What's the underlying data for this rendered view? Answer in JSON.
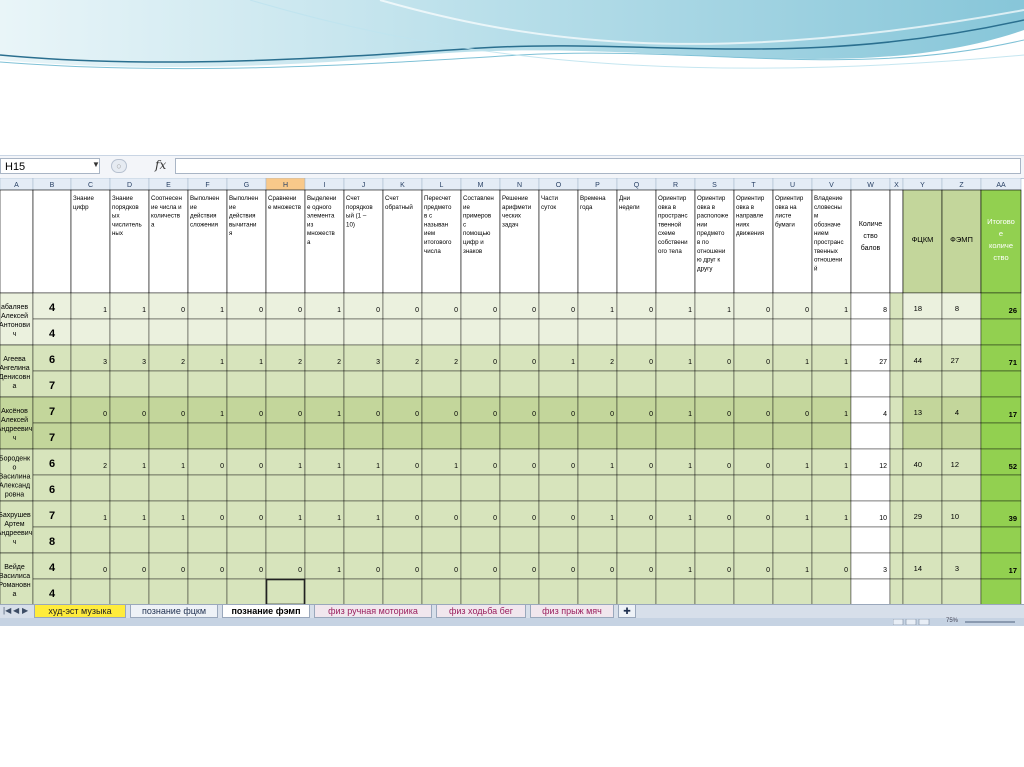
{
  "formula_bar": {
    "name_box": "H15",
    "fx": "fx",
    "formula": ""
  },
  "columns": [
    "A",
    "B",
    "C",
    "D",
    "E",
    "F",
    "G",
    "H",
    "I",
    "J",
    "K",
    "L",
    "M",
    "N",
    "O",
    "P",
    "Q",
    "R",
    "S",
    "T",
    "U",
    "V",
    "W",
    "X",
    "Y",
    "Z",
    "AA"
  ],
  "headers": {
    "C": [
      "Знание",
      "цифр"
    ],
    "D": [
      "Знание",
      "порядков",
      "ых",
      "числитель",
      "ных"
    ],
    "E": [
      "Соотнесен",
      "ие числа и",
      "количеств",
      "а"
    ],
    "F": [
      "Выполнен",
      "ие",
      "действия",
      "сложения"
    ],
    "G": [
      "Выполнен",
      "ие",
      "действия",
      "вычитани",
      "я"
    ],
    "H": [
      "Сравнени",
      "е множеств"
    ],
    "I": [
      "Выделени",
      "е одного",
      "элемента",
      "из",
      "множеств",
      "а"
    ],
    "J": [
      "Счет",
      "порядков",
      "ый (1 –",
      "10)"
    ],
    "K": [
      "Счет",
      "обратный"
    ],
    "L": [
      "Пересчет",
      "предмето",
      "в с",
      "называн",
      "ием",
      "итогового",
      "числа"
    ],
    "M": [
      "Составлен",
      "ие",
      "примеров",
      "с",
      "помощью",
      "цифр и",
      "знаков"
    ],
    "N": [
      "Решение",
      "арифмети",
      "ческих",
      "задач"
    ],
    "O": [
      "Части",
      "суток"
    ],
    "P": [
      "Времена",
      "года"
    ],
    "Q": [
      "Дни",
      "недели"
    ],
    "R": [
      "Ориентир",
      "овка в",
      "пространс",
      "твенной",
      "схеме",
      "собствени",
      "ого тела"
    ],
    "S": [
      "Ориентир",
      "овка в",
      "расположе",
      "нии",
      "предмето",
      "в по",
      "отношени",
      "ю друг к",
      "другу"
    ],
    "T": [
      "Ориентир",
      "овка в",
      "направле",
      "ниях",
      "движения"
    ],
    "U": [
      "Ориентир",
      "овка на",
      "листе",
      "бумаги"
    ],
    "V": [
      "Владение",
      "словесны",
      "м",
      "обозначе",
      "нием",
      "пространс",
      "твенных",
      "отношени",
      "й"
    ],
    "W": [
      "Количе",
      "ство",
      "балов"
    ],
    "Y": [
      "ФЦКМ"
    ],
    "Z": [
      "ФЭМП"
    ],
    "AA": [
      "Итогово",
      "е",
      "количе",
      "ство"
    ]
  },
  "children": [
    {
      "name": [
        "абаляев",
        "Алексей",
        "Антонови",
        "ч"
      ],
      "ages": [
        "4",
        "4"
      ],
      "scores": [
        "1",
        "1",
        "0",
        "1",
        "0",
        "0",
        "1",
        "0",
        "0",
        "0",
        "0",
        "0",
        "0",
        "1",
        "0",
        "1",
        "1",
        "0",
        "0",
        "1"
      ],
      "total": "8",
      "fckm": "18",
      "femp": "8",
      "itog": "26"
    },
    {
      "name": [
        "Агеева",
        "Ангелина",
        "Денисовн",
        "а"
      ],
      "ages": [
        "6",
        "7"
      ],
      "scores": [
        "3",
        "3",
        "2",
        "1",
        "1",
        "2",
        "2",
        "3",
        "2",
        "2",
        "0",
        "0",
        "1",
        "2",
        "0",
        "1",
        "0",
        "0",
        "1",
        "1"
      ],
      "total": "27",
      "fckm": "44",
      "femp": "27",
      "itog": "71"
    },
    {
      "name": [
        "Аксёнов",
        "Алексей",
        "Андреевич",
        "ч"
      ],
      "ages": [
        "7",
        "7"
      ],
      "scores": [
        "0",
        "0",
        "0",
        "1",
        "0",
        "0",
        "1",
        "0",
        "0",
        "0",
        "0",
        "0",
        "0",
        "0",
        "0",
        "1",
        "0",
        "0",
        "0",
        "1"
      ],
      "total": "4",
      "fckm": "13",
      "femp": "4",
      "itog": "17"
    },
    {
      "name": [
        "Бороденк",
        "о",
        "Василина",
        "Александ",
        "ровна"
      ],
      "ages": [
        "6",
        "6"
      ],
      "scores": [
        "2",
        "1",
        "1",
        "0",
        "0",
        "1",
        "1",
        "1",
        "0",
        "1",
        "0",
        "0",
        "0",
        "1",
        "0",
        "1",
        "0",
        "0",
        "1",
        "1"
      ],
      "total": "12",
      "fckm": "40",
      "femp": "12",
      "itog": "52"
    },
    {
      "name": [
        "Бахрушев",
        "Артем",
        "Андреевич",
        "ч"
      ],
      "ages": [
        "7",
        "8"
      ],
      "scores": [
        "1",
        "1",
        "1",
        "0",
        "0",
        "1",
        "1",
        "1",
        "0",
        "0",
        "0",
        "0",
        "0",
        "1",
        "0",
        "1",
        "0",
        "0",
        "1",
        "1"
      ],
      "total": "10",
      "fckm": "29",
      "femp": "10",
      "itog": "39"
    },
    {
      "name": [
        "Вейде",
        "Василиса",
        "Романовн",
        "а"
      ],
      "ages": [
        "4",
        "4"
      ],
      "scores": [
        "0",
        "0",
        "0",
        "0",
        "0",
        "0",
        "1",
        "0",
        "0",
        "0",
        "0",
        "0",
        "0",
        "0",
        "0",
        "1",
        "0",
        "0",
        "1",
        "0"
      ],
      "total": "3",
      "fckm": "14",
      "femp": "3",
      "itog": "17"
    }
  ],
  "sheet_tabs": [
    {
      "label": "худ-эст музыка",
      "style": "yellow"
    },
    {
      "label": "познание фцкм",
      "style": "normal"
    },
    {
      "label": "познание фэмп",
      "style": "active"
    },
    {
      "label": "физ ручная моторика",
      "style": "pink"
    },
    {
      "label": "физ ходьба бег",
      "style": "pink"
    },
    {
      "label": "физ прыж мяч",
      "style": "pink"
    }
  ],
  "status_bar": {
    "zoom": "75%"
  },
  "colors": {
    "light_green": "#ebf1de",
    "mid_green": "#d7e4bc",
    "dark_green": "#c3d69b",
    "accent_green": "#92d050",
    "selected_header": "#f9c98a"
  }
}
